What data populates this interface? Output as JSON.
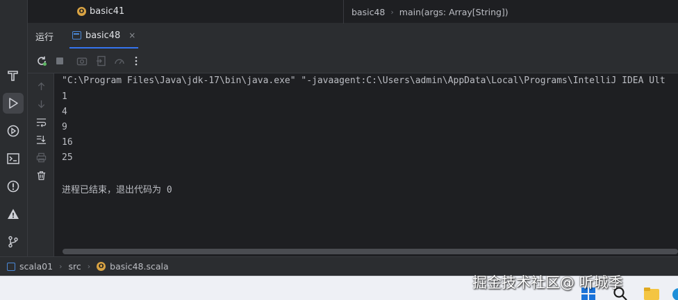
{
  "top": {
    "project_file": "basic41",
    "breadcrumb": [
      "basic48",
      "main(args: Array[String])"
    ]
  },
  "run_panel": {
    "title": "运行",
    "tab_label": "basic48",
    "close_symbol": "×"
  },
  "console": {
    "command": "\"C:\\Program Files\\Java\\jdk-17\\bin\\java.exe\" \"-javaagent:C:\\Users\\admin\\AppData\\Local\\Programs\\IntelliJ IDEA Ult",
    "output": [
      "1",
      "4",
      "9",
      "16",
      "25"
    ],
    "exit_message": "进程已结束，退出代码为 0"
  },
  "status_bar": {
    "path": [
      "scala01",
      "src",
      "basic48.scala"
    ]
  },
  "watermark": "掘金技术社区@ 听城季",
  "icons": {
    "object": "scala-object-icon",
    "tool_strip": [
      "build-icon",
      "run-icon",
      "services-icon",
      "terminal-icon",
      "problems-icon",
      "warning-icon",
      "git-icon"
    ],
    "toolbar": [
      "rerun-icon",
      "stop-icon",
      "screenshot-icon",
      "export-icon",
      "profiler-icon",
      "more-icon"
    ],
    "side": [
      "up-arrow-icon",
      "down-arrow-icon",
      "soft-wrap-icon",
      "scroll-to-end-icon",
      "print-icon",
      "trash-icon"
    ]
  },
  "colors": {
    "background": "#1e1f22",
    "panel": "#2b2d30",
    "accent": "#3574f0",
    "object_icon": "#d9a343",
    "rerun_green": "#5fb865"
  }
}
